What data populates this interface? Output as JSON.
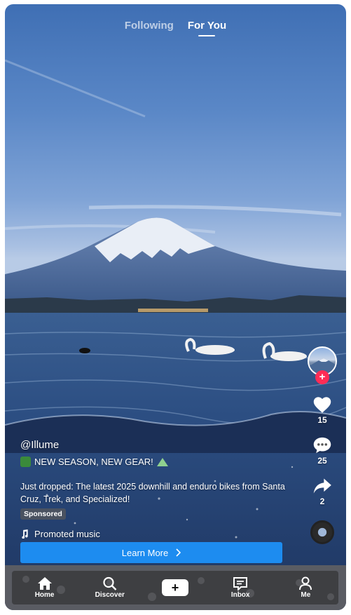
{
  "top_tabs": {
    "following": "Following",
    "for_you": "For You"
  },
  "rail": {
    "likes": "15",
    "comments": "25",
    "shares": "2"
  },
  "caption": {
    "username": "@Illume",
    "headline": "NEW SEASON, NEW GEAR!",
    "description": "Just dropped: The latest 2025 downhill and enduro bikes from Santa Cruz, Trek, and Specialized!",
    "sponsored": "Sponsored",
    "music": "Promoted music"
  },
  "cta": {
    "label": "Learn More"
  },
  "nav": {
    "home": "Home",
    "discover": "Discover",
    "inbox": "Inbox",
    "me": "Me"
  },
  "icons": {
    "home": "home-icon",
    "discover": "search-icon",
    "create": "plus-icon",
    "inbox": "inbox-icon",
    "me": "profile-icon",
    "like": "heart-icon",
    "comment": "comment-icon",
    "share": "share-icon",
    "music": "music-note-icon",
    "cta_arrow": "chevron-right-icon"
  },
  "colors": {
    "accent_red": "#fe2c55",
    "cta_blue": "#1d8cf0"
  }
}
